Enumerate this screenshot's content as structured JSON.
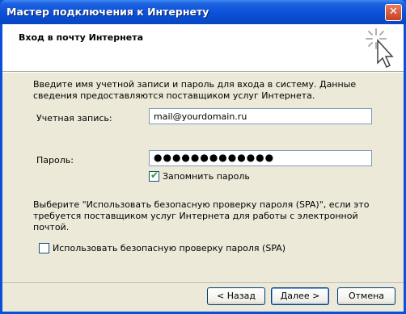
{
  "window": {
    "title": "Мастер подключения к Интернету",
    "close_glyph": "✕"
  },
  "header": {
    "title": "Вход в почту Интернета"
  },
  "form": {
    "description": "Введите имя учетной записи и пароль для входа в систему. Данные сведения предоставляются поставщиком услуг Интернета.",
    "account_label": "Учетная запись:",
    "account_value": "mail@yourdomain.ru",
    "password_label": "Пароль:",
    "password_value": "●●●●●●●●●●●●●",
    "remember_label": "Запомнить пароль",
    "remember_checked": true,
    "spa_description": "Выберите \"Использовать безопасную проверку пароля (SPA)\", если это требуется поставщиком услуг Интернета для работы с электронной почтой.",
    "spa_label": "Использовать безопасную проверку пароля (SPA)",
    "spa_checked": false
  },
  "buttons": {
    "back": "< Назад",
    "next": "Далее >",
    "cancel": "Отмена"
  }
}
